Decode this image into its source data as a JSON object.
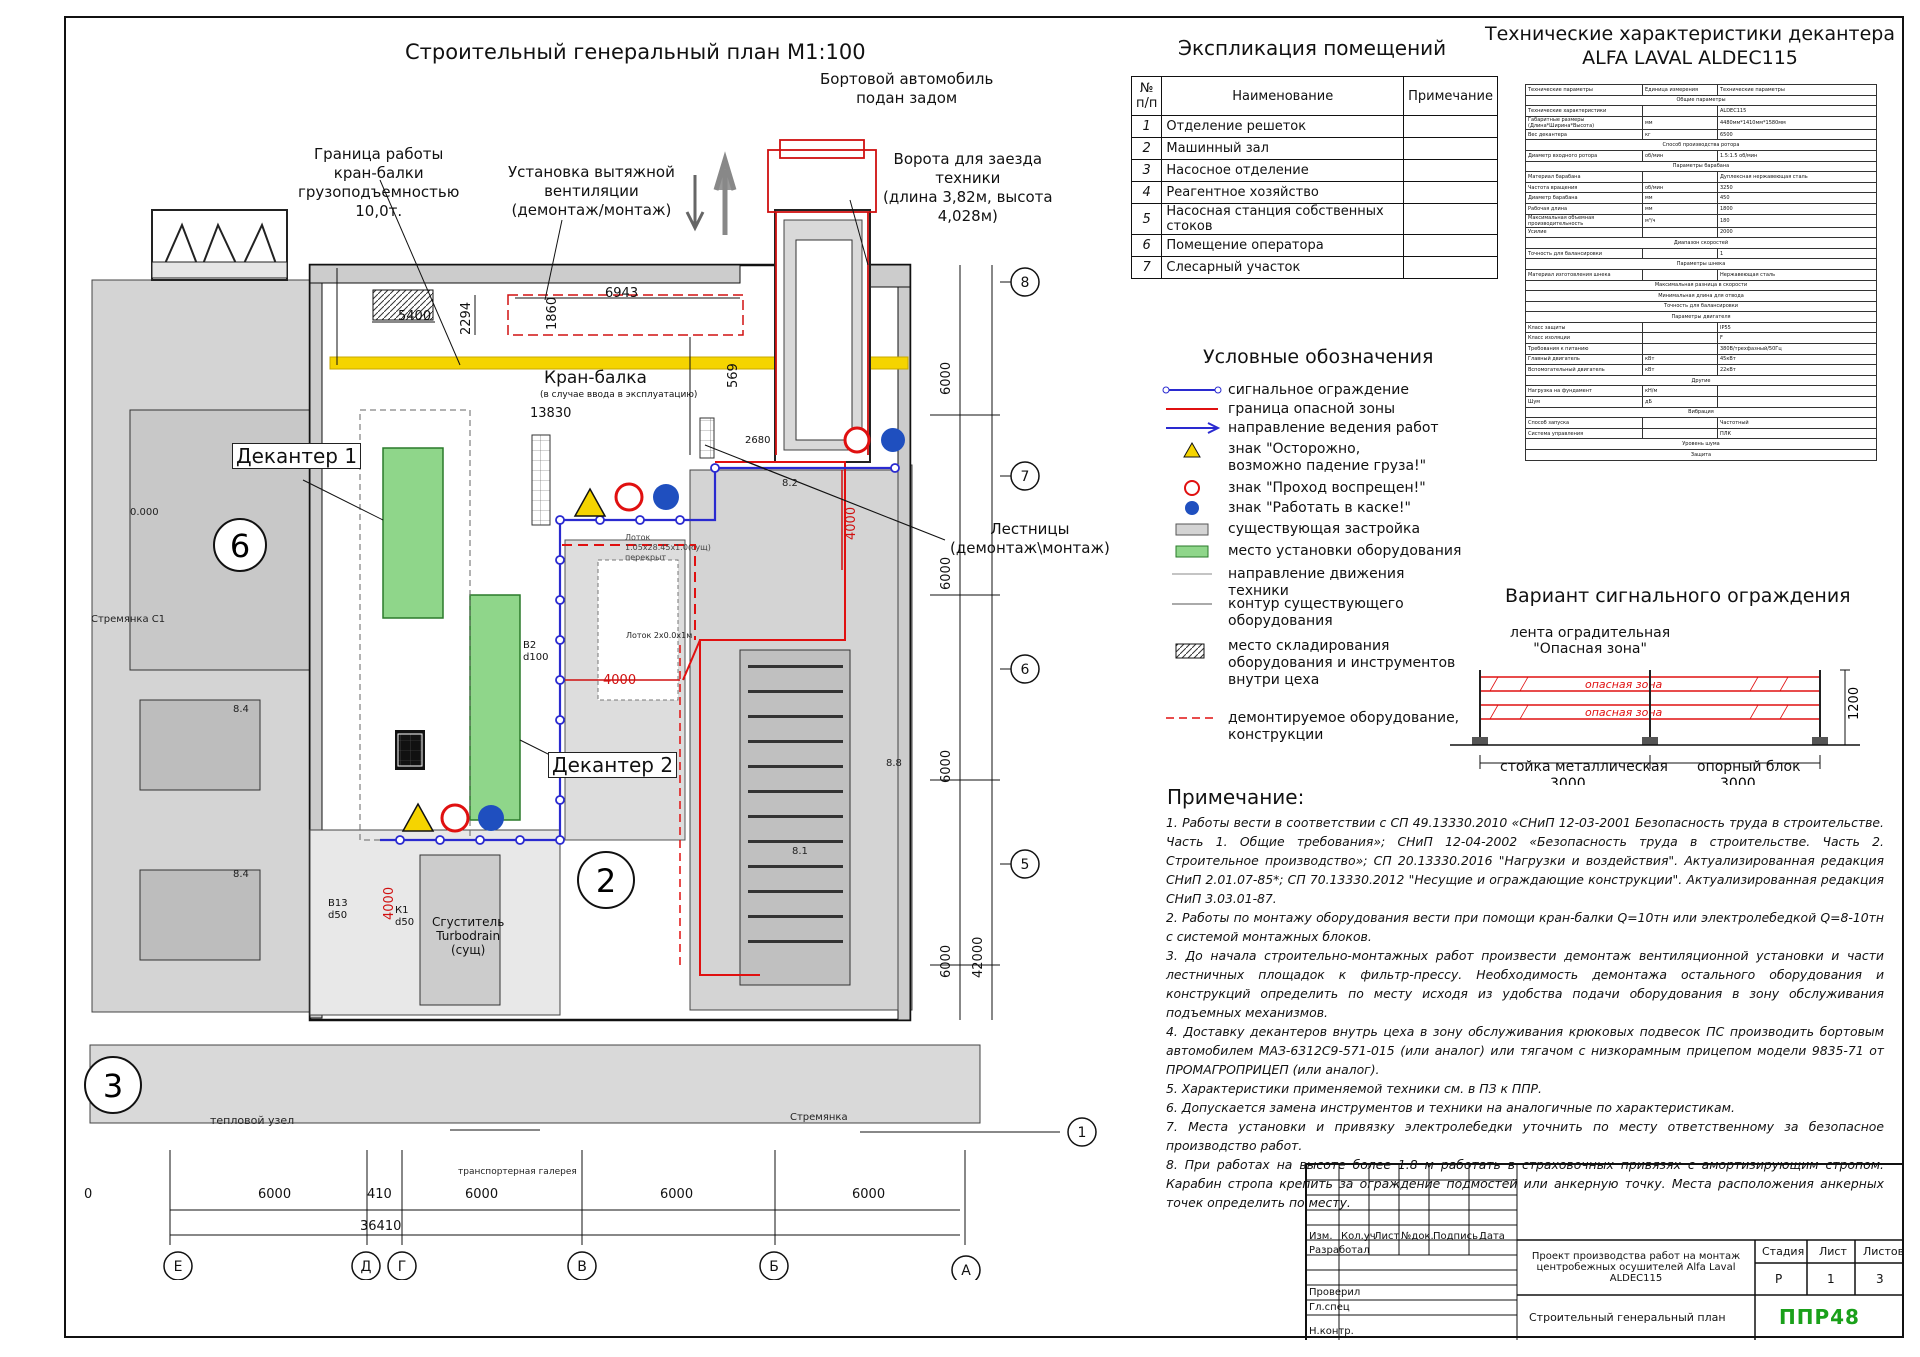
{
  "plan": {
    "title": "Строительный генеральный план М1:100",
    "vehicle": "Бортовой автомобиль\nподан задом",
    "crane_boundary": "Граница работы\nкран-балки\nгрузоподъемностью\n10,0т.",
    "vent": "Установка вытяжной\nвентиляции\n(демонтаж/монтаж)",
    "gate": "Ворота для заезда\nтехники\n(длина 3,82м, высота\n4,028м)",
    "crane_beam": "Кран-балка",
    "crane_note": "(в случае ввода в эксплуатацию)",
    "dim_13830": "13830",
    "dim_6943": "6943",
    "dim_5400": "5400",
    "dim_2294": "2294",
    "dim_1860": "1860",
    "dim_569": "569",
    "dim_2680": "2680",
    "dim_4000a": "4000",
    "dim_4000b": "4000",
    "dim_4000c": "4000",
    "decanter1": "Декантер 1",
    "decanter2": "Декантер 2",
    "stairs": "Лестницы\n(демонтаж\\монтаж)",
    "thickener": "Сгуститель\nTurbodrain\n(сущ)",
    "room6": "6",
    "room2": "2",
    "room3": "3",
    "level": "0.000",
    "heat_node": "тепловой узел",
    "transport_gallery": "транспортерная галерея",
    "ladder": "Стремянка",
    "ladder_c1": "Стремянка С1",
    "mark_84a": "8.4",
    "mark_84b": "8.4",
    "mark_82": "8.2",
    "mark_81": "8.1",
    "mark_88": "8.8",
    "b2": "В2\nd100",
    "b13": "В13\nd50",
    "k1": "К1\nd50",
    "pipe1": "Лоток\n1.05х28.45х1.0(сущ)\nперекрыт",
    "pipe2": "Лоток 2х0.0х1м",
    "dim_6000_v1": "6000",
    "dim_6000_v2": "6000",
    "dim_6000_v3": "6000",
    "dim_6000_v4": "6000",
    "dim_42000": "42000",
    "dim_6000_h1": "6000",
    "dim_6000_h2": "6000",
    "dim_6000_h3": "6000",
    "dim_6000_h4": "6000",
    "dim_410": "410",
    "dim_0": "0",
    "dim_36410": "36410",
    "axes_v": [
      "8",
      "7",
      "6",
      "5",
      "1"
    ],
    "axes_h": [
      "Е",
      "Д",
      "Г",
      "В",
      "Б",
      "А"
    ]
  },
  "explication": {
    "title": "Экспликация помещений",
    "headers": [
      "№\nп/п",
      "Наименование",
      "Примечание"
    ],
    "rows": [
      [
        "1",
        "Отделение решеток"
      ],
      [
        "2",
        "Машинный зал"
      ],
      [
        "3",
        "Насосное отделение"
      ],
      [
        "4",
        "Реагентное хозяйство"
      ],
      [
        "5",
        "Насосная станция собственных стоков"
      ],
      [
        "6",
        "Помещение оператора"
      ],
      [
        "7",
        "Слесарный участок"
      ]
    ]
  },
  "specs": {
    "title": "Технические характеристики декантера\nALFA LAVAL ALDEC115",
    "rows": [
      [
        "Технические параметры",
        "Единица измерения",
        "Технические параметры"
      ],
      [
        "Общие параметры",
        "",
        ""
      ],
      [
        "Технические характеристики",
        "",
        "ALDEC115"
      ],
      [
        "Габаритные размеры (Длина*Ширина*Высота)",
        "мм",
        "4480мм*1410мм*1580мм"
      ],
      [
        "Вес декантера",
        "кг",
        "6500"
      ],
      [
        "Способ производства ротора",
        "",
        ""
      ],
      [
        "Диаметр входного ротора",
        "об/мин",
        "1.5:1.5 об/мин"
      ],
      [
        "Параметры барабана",
        "",
        ""
      ],
      [
        "Материал барабана",
        "",
        "Дуплексная нержавеющая сталь"
      ],
      [
        "Частота вращения",
        "об/мин",
        "3250"
      ],
      [
        "Диаметр барабана",
        "мм",
        "450"
      ],
      [
        "Рабочая длина",
        "мм",
        "1800"
      ],
      [
        "Максимальная объемная производительность",
        "м³/ч",
        "180"
      ],
      [
        "Усилие",
        "",
        "2000"
      ],
      [
        "Диапазон скоростей",
        "",
        ""
      ],
      [
        "Точность для балансировки",
        "",
        "1"
      ],
      [
        "Параметры шнека",
        "",
        ""
      ],
      [
        "Материал изготовления шнека",
        "",
        "Нержавеющая сталь"
      ],
      [
        "Максимальная разница в скорости",
        "",
        ""
      ],
      [
        "Минимальная длина для отвода",
        "",
        ""
      ],
      [
        "Точность для балансировки",
        "",
        ""
      ],
      [
        "Параметры двигателя",
        "",
        ""
      ],
      [
        "Класс защиты",
        "",
        "IP55"
      ],
      [
        "Класс изоляции",
        "",
        "F"
      ],
      [
        "Требования к питанию",
        "",
        "380В/трехфазный/50Гц"
      ],
      [
        "Главный двигатель",
        "кВт",
        "45кВт"
      ],
      [
        "Вспомогательный двигатель",
        "кВт",
        "22кВт"
      ],
      [
        "Другие",
        "",
        ""
      ],
      [
        "Нагрузка на фундамент",
        "кН/м",
        ""
      ],
      [
        "Шум",
        "дБ",
        ""
      ],
      [
        "Вибрация",
        "",
        ""
      ],
      [
        "Способ запуска",
        "",
        "Частотный"
      ],
      [
        "Система управления",
        "",
        "ПЛК"
      ],
      [
        "Уровень шума",
        "",
        ""
      ],
      [
        "Защита",
        "",
        ""
      ]
    ]
  },
  "legend": {
    "title": "Условные обозначения",
    "items": [
      "сигнальное ограждение",
      "граница опасной зоны",
      "направление ведения работ",
      "знак \"Осторожно,\nвозможно падение груза!\"",
      "знак \"Проход воспрещен!\"",
      "знак \"Работать в каске!\"",
      "существующая застройка",
      "место установки оборудования",
      "направление движения\nтехники",
      "контур существующего\nоборудования",
      "место складирования\nоборудования и инструментов\nвнутри цеха",
      "демонтируемое оборудование,\nконструкции"
    ]
  },
  "fence": {
    "title": "Вариант сигнального ограждения",
    "tape": "лента оградительная\n\"Опасная зона\"",
    "band_text": "опасная зона",
    "post": "стойка металлическая",
    "block": "опорный блок",
    "dim1": "3000",
    "dim2": "3000",
    "height": "1200"
  },
  "notes": {
    "title": "Примечание:",
    "items": [
      "1.  Работы вести в соответствии с СП 49.13330.2010 «СНиП 12-03-2001 Безопасность труда в строительстве. Часть 1. Общие требования»; СНиП 12-04-2002 «Безопасность труда в строительстве. Часть 2. Строительное производство»; СП 20.13330.2016 \"Нагрузки и воздействия\". Актуализированная редакция СНиП 2.01.07-85*; СП 70.13330.2012 \"Несущие и ограждающие конструкции\". Актуализированная редакция СНиП 3.03.01-87.",
      "2.  Работы по монтажу оборудования вести при помощи кран-балки Q=10тн или электролебедкой Q=8-10тн с системой монтажных блоков.",
      "3.  До начала строительно-монтажных работ произвести демонтаж вентиляционной установки и части лестничных площадок к фильтр-прессу. Необходимость демонтажа остального оборудования и конструкций определить по месту исходя из удобства подачи оборудования в зону обслуживания подъемных механизмов.",
      "4.  Доставку декантеров внутрь цеха в зону обслуживания крюковых подвесок ПС производить бортовым автомобилем МАЗ-6312С9-571-015 (или аналог) или тягачом с низкорамным прицепом модели 9835-71 от ПРОМАГРОПРИЦЕП (или аналог).",
      "5.  Характеристики применяемой техники см. в ПЗ к ППР.",
      "6.  Допускается замена инструментов и техники на аналогичные по характеристикам.",
      "7.  Места установки и привязку электролебедки уточнить по месту ответственному за безопасное производство работ.",
      "8.  При работах на высоте более 1.8 м работать в страховочных привязях с амортизирующим стропом. Карабин стропа крепить за ограждение подмостей или анкерную точку. Места расположения анкерных точек определить по месту."
    ]
  },
  "stamp": {
    "cols": [
      "Изм.",
      "Кол.уч",
      "Лист",
      "№док.",
      "Подпись",
      "Дата"
    ],
    "roles": [
      "Разработал",
      "Проверил",
      "Гл.спец",
      "Н.контр."
    ],
    "project": "Проект производства работ на монтаж центробежных осушителей Alfa Laval ALDEC115",
    "sheet_title": "Строительный генеральный план",
    "stage_label": "Стадия",
    "sheet_label": "Лист",
    "sheets_label": "Листов",
    "stage": "Р",
    "sheet": "1",
    "sheets": "3",
    "logo": "ППР48"
  },
  "colors": {
    "fence": "#2a2ad0",
    "danger": "#e01010",
    "equipment": "#8fd68a",
    "existing": "#d4d4d4",
    "crane": "#f5d400",
    "logo": "#1aa01a"
  }
}
